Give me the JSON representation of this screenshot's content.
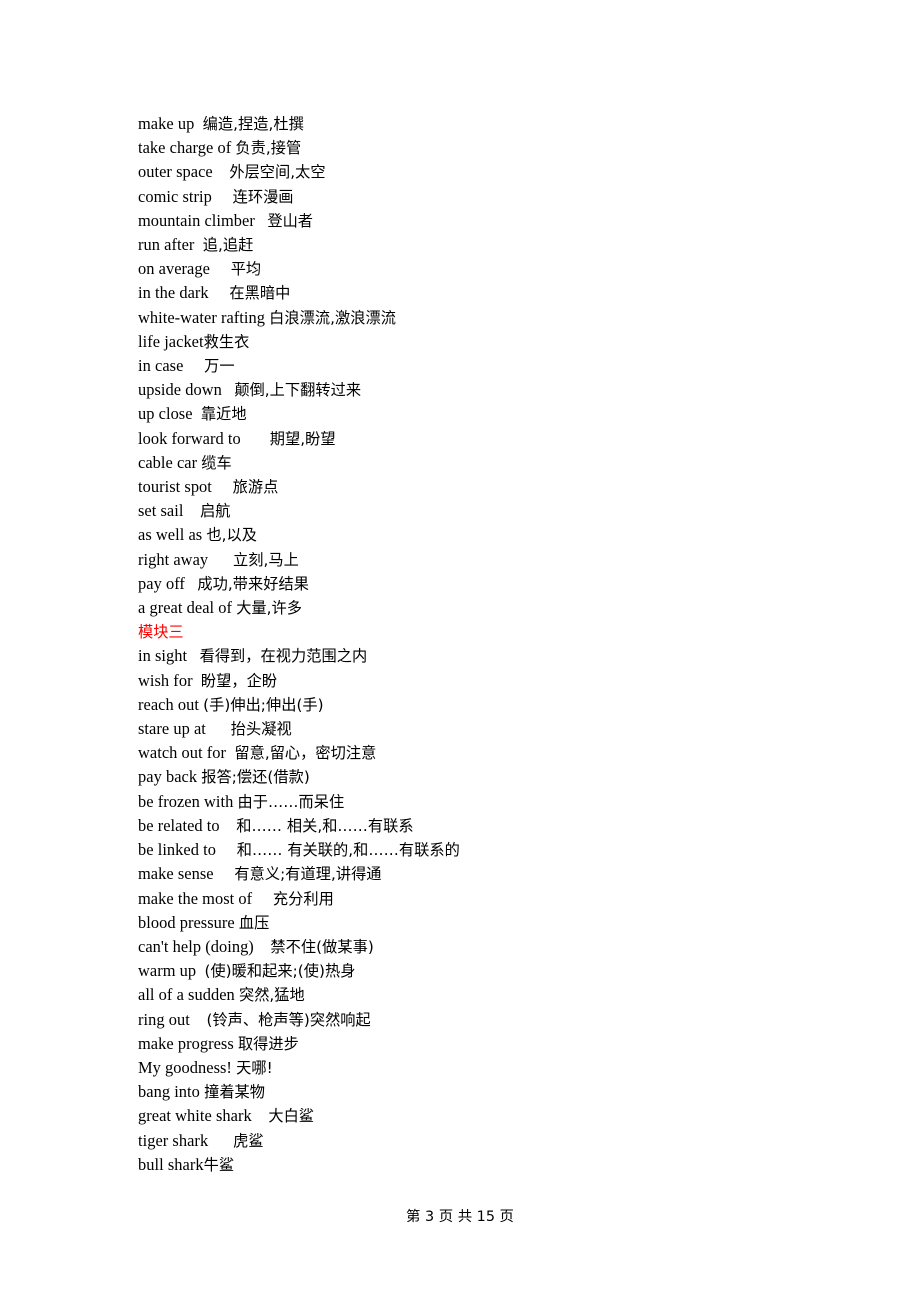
{
  "document": {
    "lines": [
      {
        "kind": "entry",
        "term": "make up",
        "gap": "  ",
        "gloss": "编造,捏造,杜撰"
      },
      {
        "kind": "entry",
        "term": "take charge of",
        "gap": " ",
        "gloss": "负责,接管"
      },
      {
        "kind": "entry",
        "term": "outer space",
        "gap": "    ",
        "gloss": "外层空间,太空"
      },
      {
        "kind": "entry",
        "term": "comic strip",
        "gap": "     ",
        "gloss": "连环漫画"
      },
      {
        "kind": "entry",
        "term": "mountain climber",
        "gap": "   ",
        "gloss": "登山者"
      },
      {
        "kind": "entry",
        "term": "run after",
        "gap": "  ",
        "gloss": "追,追赶"
      },
      {
        "kind": "entry",
        "term": "on average",
        "gap": "     ",
        "gloss": "平均"
      },
      {
        "kind": "entry",
        "term": "in the dark",
        "gap": "     ",
        "gloss": "在黑暗中"
      },
      {
        "kind": "entry",
        "term": "white-water rafting",
        "gap": " ",
        "gloss": "白浪漂流,激浪漂流"
      },
      {
        "kind": "entry",
        "term": "life jacket",
        "gap": "",
        "gloss": "救生衣"
      },
      {
        "kind": "entry",
        "term": "in case",
        "gap": "     ",
        "gloss": "万一"
      },
      {
        "kind": "entry",
        "term": "upside down",
        "gap": "   ",
        "gloss": "颠倒,上下翻转过来"
      },
      {
        "kind": "entry",
        "term": "up close",
        "gap": "  ",
        "gloss": "靠近地"
      },
      {
        "kind": "entry",
        "term": "look forward to",
        "gap": "       ",
        "gloss": "期望,盼望"
      },
      {
        "kind": "entry",
        "term": "cable car",
        "gap": " ",
        "gloss": "缆车"
      },
      {
        "kind": "entry",
        "term": "tourist spot",
        "gap": "     ",
        "gloss": "旅游点"
      },
      {
        "kind": "entry",
        "term": "set sail",
        "gap": "    ",
        "gloss": "启航"
      },
      {
        "kind": "entry",
        "term": "as well as",
        "gap": " ",
        "gloss": "也,以及"
      },
      {
        "kind": "entry",
        "term": "right away",
        "gap": "      ",
        "gloss": "立刻,马上"
      },
      {
        "kind": "entry",
        "term": "pay off",
        "gap": "   ",
        "gloss": "成功,带来好结果"
      },
      {
        "kind": "entry",
        "term": "a great deal of",
        "gap": " ",
        "gloss": "大量,许多"
      },
      {
        "kind": "heading",
        "text": "模块三"
      },
      {
        "kind": "entry",
        "term": "in sight",
        "gap": "   ",
        "gloss": "看得到，在视力范围之内"
      },
      {
        "kind": "entry",
        "term": "wish for",
        "gap": "  ",
        "gloss": "盼望，企盼"
      },
      {
        "kind": "entry",
        "term": "reach out",
        "gap": " ",
        "gloss": "(手)伸出;伸出(手)"
      },
      {
        "kind": "entry",
        "term": "stare up at",
        "gap": "      ",
        "gloss": "抬头凝视"
      },
      {
        "kind": "entry",
        "term": "watch out for",
        "gap": "  ",
        "gloss": "留意,留心，密切注意"
      },
      {
        "kind": "entry",
        "term": "pay back",
        "gap": " ",
        "gloss": "报答;偿还(借款)"
      },
      {
        "kind": "entry",
        "term": "be frozen with",
        "gap": " ",
        "gloss": "由于……而呆住"
      },
      {
        "kind": "entry",
        "term": "be related to",
        "gap": "    ",
        "gloss": "和…… 相关,和……有联系"
      },
      {
        "kind": "entry",
        "term": "be linked to",
        "gap": "     ",
        "gloss": "和…… 有关联的,和……有联系的"
      },
      {
        "kind": "entry",
        "term": "make sense",
        "gap": "     ",
        "gloss": "有意义;有道理,讲得通"
      },
      {
        "kind": "entry",
        "term": "make the most of",
        "gap": "     ",
        "gloss": "充分利用"
      },
      {
        "kind": "entry",
        "term": "blood pressure",
        "gap": " ",
        "gloss": "血压"
      },
      {
        "kind": "entry",
        "term": "can't help (doing)",
        "gap": "    ",
        "gloss": "禁不住(做某事)"
      },
      {
        "kind": "entry",
        "term": "warm up",
        "gap": "  ",
        "gloss": "(使)暖和起来;(使)热身"
      },
      {
        "kind": "entry",
        "term": "all of a sudden",
        "gap": " ",
        "gloss": "突然,猛地"
      },
      {
        "kind": "entry",
        "term": "ring out",
        "gap": "    ",
        "gloss": "(铃声、枪声等)突然响起"
      },
      {
        "kind": "entry",
        "term": "make progress",
        "gap": " ",
        "gloss": "取得进步"
      },
      {
        "kind": "entry",
        "term": "My goodness!",
        "gap": " ",
        "gloss": "天哪!"
      },
      {
        "kind": "entry",
        "term": "bang into",
        "gap": " ",
        "gloss": "撞着某物"
      },
      {
        "kind": "entry",
        "term": "great white shark",
        "gap": "    ",
        "gloss": "大白鲨"
      },
      {
        "kind": "entry",
        "term": "tiger shark",
        "gap": "      ",
        "gloss": "虎鲨"
      },
      {
        "kind": "entry",
        "term": "bull shark",
        "gap": "",
        "gloss": "牛鲨"
      }
    ]
  },
  "footer": {
    "text": "第 3 页 共 15 页",
    "page_number": "3",
    "total_pages": "15"
  },
  "colors": {
    "heading": "#ff0000",
    "body_text": "#000000",
    "background": "#ffffff"
  }
}
